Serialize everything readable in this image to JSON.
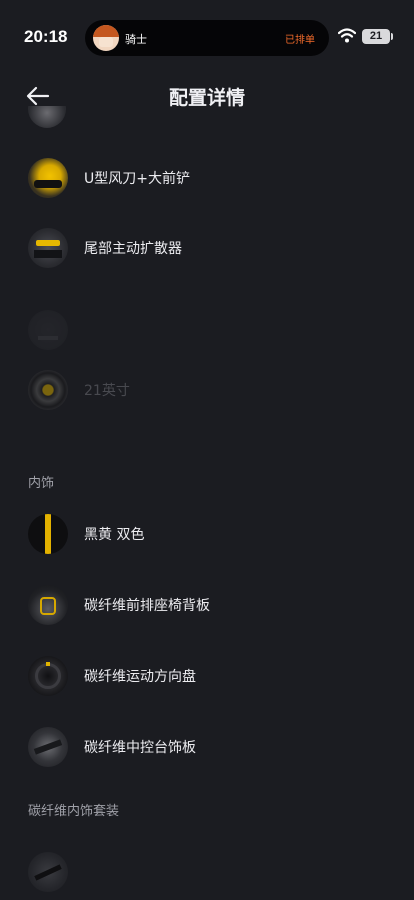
{
  "status_bar": {
    "time": "20:18",
    "pill_name": "骑士",
    "pill_status": "已排单",
    "battery": "21"
  },
  "header": {
    "title": "配置详情"
  },
  "exterior_items": [
    {
      "label": "U型风刀+大前铲",
      "icon": "yellow-car-front-thumb"
    },
    {
      "label": "尾部主动扩散器",
      "icon": "rear-diffuser-thumb"
    },
    {
      "label": "",
      "icon": "dark-part-thumb"
    },
    {
      "label": "21英寸",
      "icon": "wheel-thumb"
    }
  ],
  "interior": {
    "section_title": "内饰",
    "items": [
      {
        "label": "黑黄 双色",
        "icon": "black-yellow-stripe-thumb"
      },
      {
        "label": "碳纤维前排座椅背板",
        "icon": "seat-back-thumb"
      },
      {
        "label": "碳纤维运动方向盘",
        "icon": "steering-wheel-thumb"
      },
      {
        "label": "碳纤维中控台饰板",
        "icon": "console-trim-thumb"
      }
    ]
  },
  "interior_kit": {
    "section_title": "碳纤维内饰套装"
  },
  "colors": {
    "background": "#1b1c21",
    "accent_yellow": "#e3b200",
    "status_orange": "#f26b2b"
  }
}
